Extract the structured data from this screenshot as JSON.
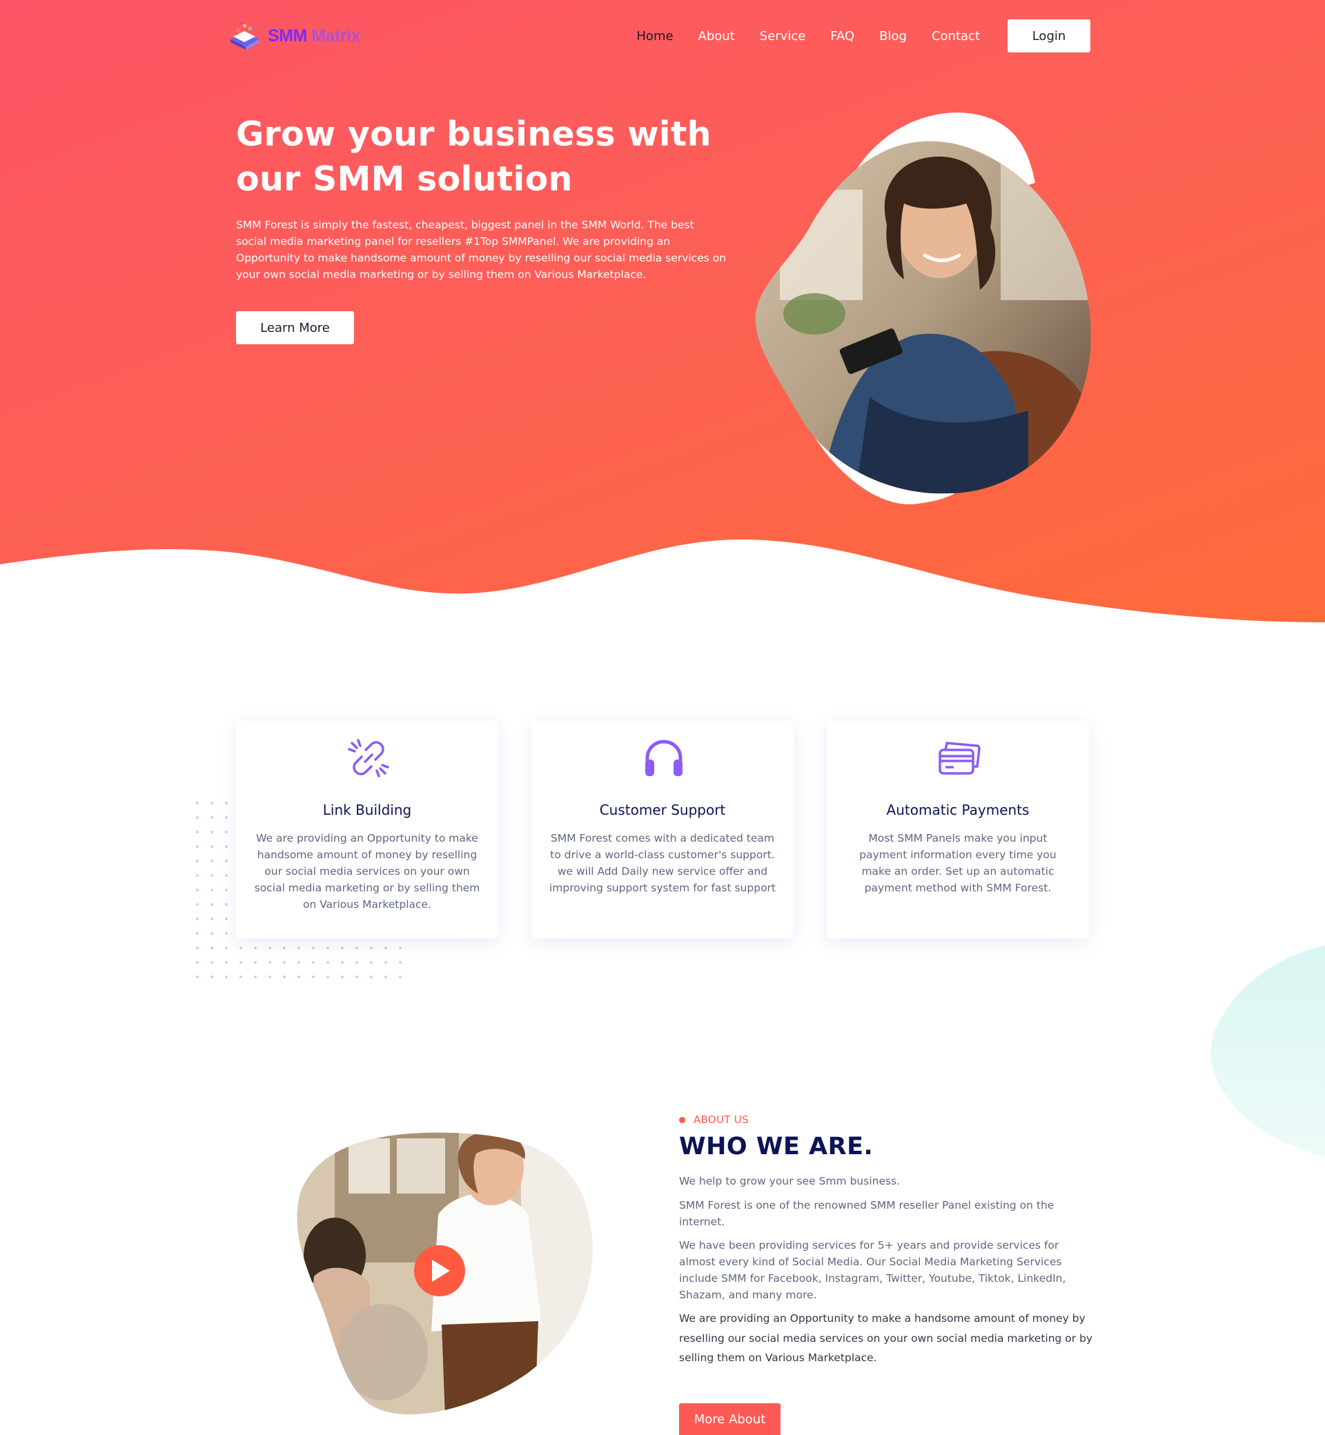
{
  "brand": {
    "logo_part1": "SMM",
    "logo_part2": "Matrix",
    "primary_color": "#fd5a55",
    "accent_purple": "#7b2cf5",
    "navy": "#0c1456"
  },
  "nav": {
    "items": [
      {
        "label": "Home",
        "active": true
      },
      {
        "label": "About"
      },
      {
        "label": "Service"
      },
      {
        "label": "FAQ"
      },
      {
        "label": "Blog"
      },
      {
        "label": "Contact"
      }
    ],
    "login_label": "Login"
  },
  "hero": {
    "title": "Grow your business with our SMM solution",
    "description": "SMM Forest is simply the fastest, cheapest, biggest panel in the SMM World. The best social media marketing panel for resellers #1Top SMMPanel. We are providing an Opportunity to make handsome amount of money by reselling our social media services on your own social media marketing or by selling them on Various Marketplace.",
    "cta_label": "Learn More"
  },
  "features": [
    {
      "icon": "link-icon",
      "title": "Link Building",
      "text": "We are providing an Opportunity to make handsome amount of money by reselling our social media services on your own social media marketing or by selling them on Various Marketplace."
    },
    {
      "icon": "headphones-icon",
      "title": "Customer Support",
      "text": "SMM Forest comes with a dedicated team to drive a world-class customer's support. we will Add Daily new service offer and improving support system for fast support"
    },
    {
      "icon": "credit-card-icon",
      "title": "Automatic Payments",
      "text": "Most SMM Panels make you input payment information every time you make an order. Set up an automatic payment method with  SMM Forest."
    }
  ],
  "about": {
    "eyebrow": "ABOUT US",
    "title": "WHO WE ARE.",
    "paragraphs": [
      "We help to grow your see Smm business.",
      "SMM Forest is one of the renowned SMM reseller Panel existing on the internet.",
      "We have been providing services for 5+ years and provide services for almost every kind of Social Media. Our Social Media Marketing Services include SMM for Facebook, Instagram, Twitter, Youtube, Tiktok, LinkedIn, Shazam, and many more.",
      "We are providing an Opportunity to make a handsome amount of money by reselling our social media services on your own social media marketing or by selling them on Various Marketplace."
    ],
    "cta_label": "More About",
    "play_icon": "play-icon"
  }
}
